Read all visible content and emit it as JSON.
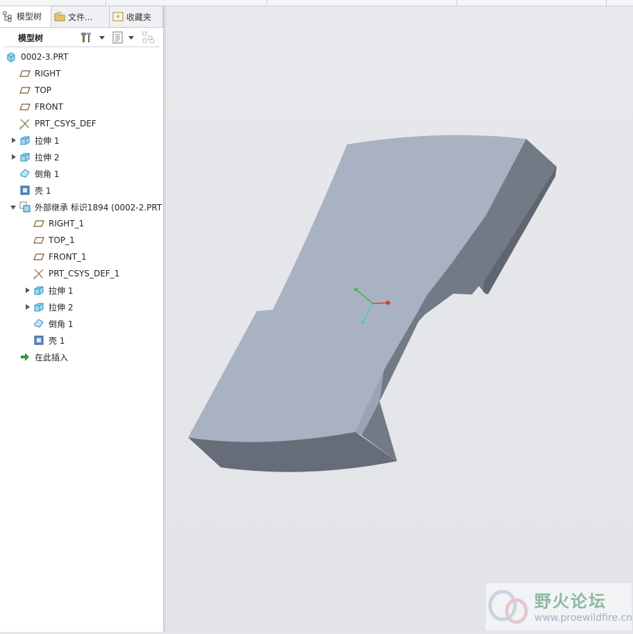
{
  "tabs": [
    {
      "label": "模型树",
      "icon": "model-tree-icon"
    },
    {
      "label": "文件...",
      "icon": "folder-icon"
    },
    {
      "label": "收藏夹",
      "icon": "favorites-icon"
    }
  ],
  "toolbar": {
    "title": "模型树",
    "icons": [
      "settings-icon",
      "show-icon",
      "filter-icon"
    ]
  },
  "tree": {
    "root": {
      "label": "0002-3.PRT",
      "icon": "part-icon"
    },
    "items": [
      {
        "label": "RIGHT",
        "icon": "datum-plane-icon",
        "expand": "none",
        "indent": 1
      },
      {
        "label": "TOP",
        "icon": "datum-plane-icon",
        "expand": "none",
        "indent": 1
      },
      {
        "label": "FRONT",
        "icon": "datum-plane-icon",
        "expand": "none",
        "indent": 1
      },
      {
        "label": "PRT_CSYS_DEF",
        "icon": "csys-icon",
        "expand": "none",
        "indent": 1
      },
      {
        "label": "拉伸 1",
        "icon": "extrude-icon",
        "expand": "collapsed",
        "indent": 1
      },
      {
        "label": "拉伸 2",
        "icon": "extrude-icon",
        "expand": "collapsed",
        "indent": 1
      },
      {
        "label": "倒角 1",
        "icon": "chamfer-icon",
        "expand": "none",
        "indent": 1
      },
      {
        "label": "壳 1",
        "icon": "shell-icon",
        "expand": "none",
        "indent": 1
      },
      {
        "label": "外部继承 标识1894 (0002-2.PRT",
        "icon": "external-inheritance-icon",
        "expand": "expanded",
        "indent": 1
      },
      {
        "label": "RIGHT_1",
        "icon": "datum-plane-icon",
        "expand": "none",
        "indent": 2
      },
      {
        "label": "TOP_1",
        "icon": "datum-plane-icon",
        "expand": "none",
        "indent": 2
      },
      {
        "label": "FRONT_1",
        "icon": "datum-plane-icon",
        "expand": "none",
        "indent": 2
      },
      {
        "label": "PRT_CSYS_DEF_1",
        "icon": "csys-icon",
        "expand": "none",
        "indent": 2
      },
      {
        "label": "拉伸 1",
        "icon": "extrude-icon",
        "expand": "collapsed",
        "indent": 2
      },
      {
        "label": "拉伸 2",
        "icon": "extrude-icon",
        "expand": "collapsed",
        "indent": 2
      },
      {
        "label": "倒角 1",
        "icon": "chamfer-icon",
        "expand": "none",
        "indent": 2
      },
      {
        "label": "壳 1",
        "icon": "shell-icon",
        "expand": "none",
        "indent": 2
      },
      {
        "label": "在此插入",
        "icon": "insert-here-arrow-icon",
        "expand": "none",
        "indent": 1
      }
    ]
  },
  "watermark": {
    "title": "野火论坛",
    "url": "www.proewildfire.cn"
  },
  "colors": {
    "model_top": "#a7b2c2",
    "model_side": "#6f7782",
    "model_dark": "#5d636b",
    "viewport_bg": "#e6e7ea"
  }
}
